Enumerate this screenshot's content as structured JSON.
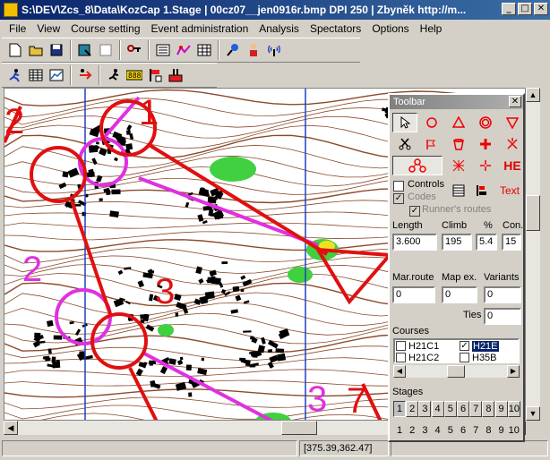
{
  "window": {
    "title": "S:\\DEV\\Zcs_8\\Data\\KozCap 1.Stage  | 00cz07__jen0916r.bmp DPI 250 | Zbyněk  http://m...",
    "min": "_",
    "max": "□",
    "close": "✕"
  },
  "menu": [
    "File",
    "View",
    "Course setting",
    "Event administration",
    "Analysis",
    "Spectators",
    "Options",
    "Help"
  ],
  "status": {
    "cell1": "",
    "coords": "[375.39,362.47]",
    "cell3": ""
  },
  "palette": {
    "title": "Toolbar",
    "close": "✕",
    "tool_he": "HE",
    "tool_text": "Text",
    "controls_label": "Controls",
    "codes_label": "Codes",
    "runners_label": "Runner's routes",
    "length_label": "Length",
    "climb_label": "Climb",
    "pct_label": "%",
    "con_label": "Con.",
    "length_value": "3.600",
    "climb_value": "195",
    "pct_value": "5.4",
    "con_value": "15",
    "mar_label": "Mar.route",
    "mapex_label": "Map ex.",
    "variants_label": "Variants",
    "mar_value": "0",
    "mapex_value": "0",
    "variants_value": "0",
    "ties_label": "Ties",
    "ties_value": "0",
    "courses_label": "Courses",
    "courses": [
      {
        "name": "H21C1",
        "checked": false
      },
      {
        "name": "H21E",
        "checked": true
      },
      {
        "name": "H21C2",
        "checked": false
      },
      {
        "name": "H35B",
        "checked": false
      }
    ],
    "stages_label": "Stages",
    "stage_buttons": [
      "1",
      "2",
      "3",
      "4",
      "5",
      "6",
      "7",
      "8",
      "9",
      "10"
    ],
    "stage_numbers": [
      "1",
      "2",
      "3",
      "4",
      "5",
      "6",
      "7",
      "8",
      "9",
      "10"
    ]
  },
  "map": {
    "labels": [
      "1",
      "2",
      "2",
      "3",
      "3",
      "7"
    ],
    "colors": {
      "course": "#e01010",
      "route": "#e030e0",
      "grid": "#2040c0",
      "contour": "#8b4a2a",
      "green": "#40d040"
    }
  }
}
